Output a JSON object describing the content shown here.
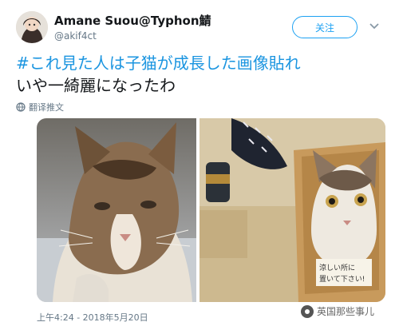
{
  "author": {
    "name": "Amane Suou@Typhon鯖",
    "handle": "@akif4ct"
  },
  "follow_button": {
    "label": "关注"
  },
  "tweet": {
    "hashtag": "#これ見た人は子猫が成長した画像貼れ",
    "text": "いや一綺麗になったわ",
    "translate_label": "翻译推文"
  },
  "media": {
    "left_photo": "kitten-photo",
    "right_photo": "grown-cat-in-box-photo",
    "box_label": "涼しい所に置いて下さい!"
  },
  "timestamp": "上午4:24 - 2018年5月20日",
  "watermark": {
    "text": "英国那些事儿"
  },
  "colors": {
    "accent": "#1da1f2",
    "hashtag": "#1b95e0",
    "muted": "#657786"
  }
}
